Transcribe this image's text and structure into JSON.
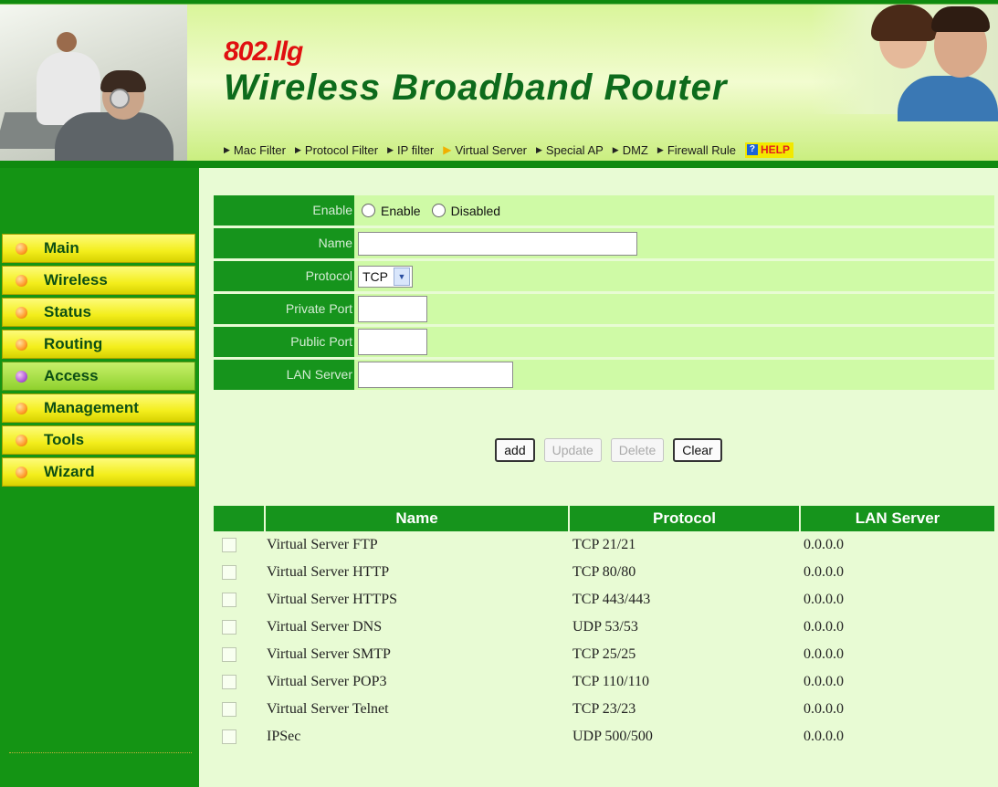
{
  "header": {
    "subtitle": "802.llg",
    "title": "Wireless Broadband Router",
    "nav": [
      "Mac Filter",
      "Protocol Filter",
      "IP filter",
      "Virtual Server",
      "Special AP",
      "DMZ",
      "Firewall Rule"
    ],
    "active_nav": "Virtual Server",
    "help_label": "HELP"
  },
  "sidebar": {
    "items": [
      "Main",
      "Wireless",
      "Status",
      "Routing",
      "Access",
      "Management",
      "Tools",
      "Wizard"
    ],
    "active": "Access"
  },
  "form": {
    "enable_label": "Enable",
    "enable_option": "Enable",
    "disabled_option": "Disabled",
    "name_label": "Name",
    "name_value": "",
    "protocol_label": "Protocol",
    "protocol_value": "TCP",
    "private_port_label": "Private Port",
    "private_port_value": "",
    "public_port_label": "Public Port",
    "public_port_value": "",
    "lan_server_label": "LAN Server",
    "lan_server_value": ""
  },
  "buttons": {
    "add": "add",
    "update": "Update",
    "delete": "Delete",
    "clear": "Clear"
  },
  "table": {
    "headers": [
      "Name",
      "Protocol",
      "LAN Server"
    ],
    "rows": [
      {
        "name": "Virtual Server FTP",
        "protocol": "TCP 21/21",
        "lan": "0.0.0.0"
      },
      {
        "name": "Virtual Server HTTP",
        "protocol": "TCP 80/80",
        "lan": "0.0.0.0"
      },
      {
        "name": "Virtual Server HTTPS",
        "protocol": "TCP 443/443",
        "lan": "0.0.0.0"
      },
      {
        "name": "Virtual Server DNS",
        "protocol": "UDP 53/53",
        "lan": "0.0.0.0"
      },
      {
        "name": "Virtual Server SMTP",
        "protocol": "TCP 25/25",
        "lan": "0.0.0.0"
      },
      {
        "name": "Virtual Server POP3",
        "protocol": "TCP 110/110",
        "lan": "0.0.0.0"
      },
      {
        "name": "Virtual Server Telnet",
        "protocol": "TCP 23/23",
        "lan": "0.0.0.0"
      },
      {
        "name": "IPSec",
        "protocol": "UDP 500/500",
        "lan": "0.0.0.0"
      }
    ]
  },
  "colors": {
    "brand_green": "#16941c",
    "content_bg": "#e8fbd4",
    "field_bg": "#cffaa6",
    "menu_yellow": "#f3ee1c",
    "brand_red": "#e01010"
  }
}
